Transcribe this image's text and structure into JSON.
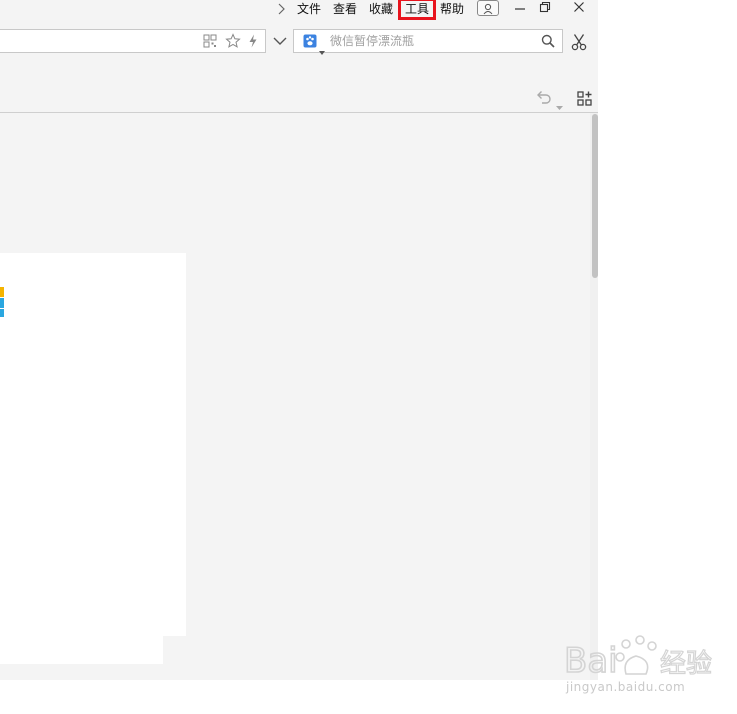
{
  "menubar": {
    "items": [
      "文件",
      "查看",
      "收藏",
      "工具",
      "帮助"
    ]
  },
  "search": {
    "placeholder": "微信暂停漂流瓶"
  },
  "watermark": {
    "brand": "Bai",
    "brand2": "经验",
    "url": "jingyan.baidu.com"
  },
  "colors": {
    "highlight": "#e8141e",
    "chrome": "#f4f4f4",
    "accent": "#3b82e0"
  }
}
